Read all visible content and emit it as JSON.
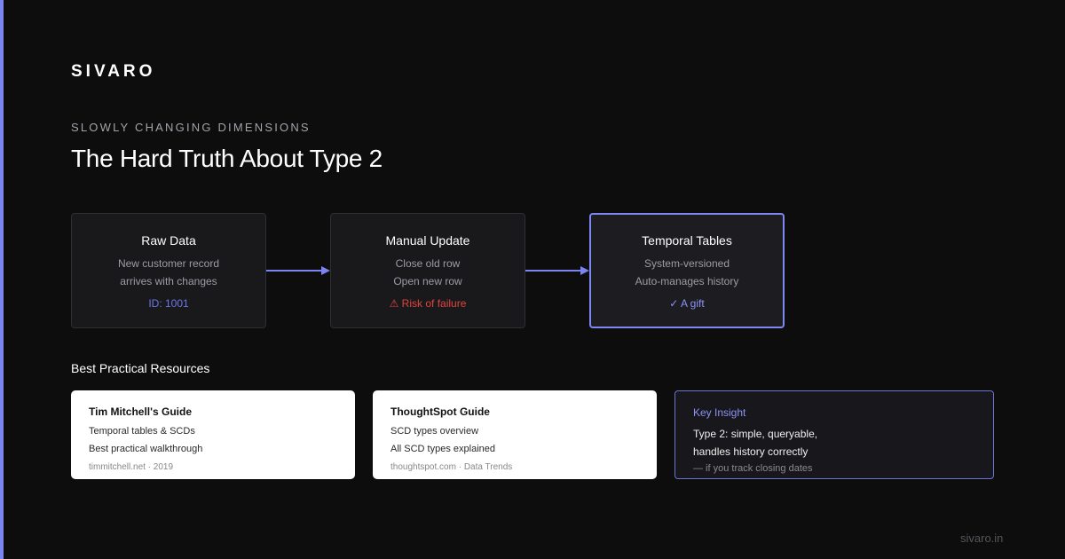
{
  "brand": "SIVARO",
  "eyebrow": "SLOWLY CHANGING DIMENSIONS",
  "title": "The Hard Truth About Type 2",
  "colors": {
    "background": "#0d0d0e",
    "accent": "#7b84f0",
    "link_blue": "#6c78e6",
    "warning_red": "#e0443e"
  },
  "flow": {
    "steps": [
      {
        "title": "Raw Data",
        "line1": "New customer record",
        "line2": "arrives with changes",
        "tag": "ID: 1001",
        "tag_color": "#6c78e6"
      },
      {
        "title": "Manual Update",
        "line1": "Close old row",
        "line2": "Open new row",
        "tag": "⚠ Risk of failure",
        "tag_color": "#e0443e"
      },
      {
        "title": "Temporal Tables",
        "line1": "System-versioned",
        "line2": "Auto-manages history",
        "tag": "✓ A gift",
        "tag_color": "#8c93f6"
      }
    ]
  },
  "resources": {
    "label": "Best Practical Resources",
    "cards": [
      {
        "title": "Tim Mitchell's Guide",
        "line1": "Temporal tables & SCDs",
        "line2": "Best practical walkthrough",
        "meta": "timmitchell.net · 2019"
      },
      {
        "title": "ThoughtSpot Guide",
        "line1": "SCD types overview",
        "line2": "All SCD types explained",
        "meta": "thoughtspot.com · Data Trends"
      }
    ],
    "insight": {
      "title": "Key Insight",
      "line1": "Type 2: simple, queryable,",
      "line2": "handles history correctly",
      "note": "— if you track closing dates"
    }
  },
  "footer": "sivaro.in"
}
